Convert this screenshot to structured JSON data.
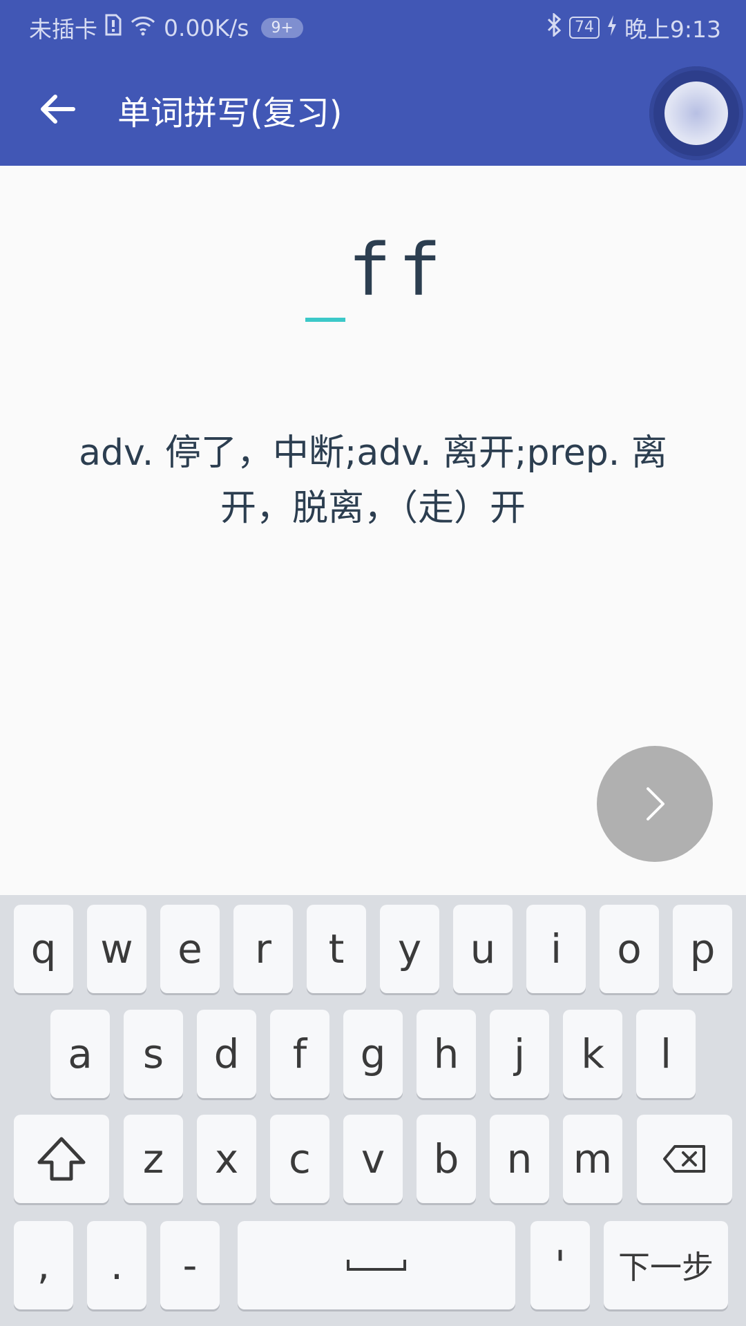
{
  "status_bar": {
    "carrier": "未插卡",
    "speed": "0.00K/s",
    "notification_count": "9+",
    "battery": "74",
    "time": "晚上9:13"
  },
  "app_bar": {
    "title": "单词拼写(复习)"
  },
  "word": {
    "masked": "_ff",
    "visible_part": "ff"
  },
  "definition": "adv. 停了，中断;adv. 离开;prep. 离开，脱离，（走）开",
  "keyboard": {
    "row1": [
      "q",
      "w",
      "e",
      "r",
      "t",
      "y",
      "u",
      "i",
      "o",
      "p"
    ],
    "row2": [
      "a",
      "s",
      "d",
      "f",
      "g",
      "h",
      "j",
      "k",
      "l"
    ],
    "row3": [
      "z",
      "x",
      "c",
      "v",
      "b",
      "n",
      "m"
    ],
    "row4": {
      "comma": ",",
      "period": ".",
      "dash": "-",
      "apostrophe": "'",
      "next": "下一步"
    }
  },
  "colors": {
    "primary": "#4157b5",
    "accent": "#3cc8c8",
    "fab": "#b0b0b0",
    "keyboard_bg": "#dadde2"
  }
}
